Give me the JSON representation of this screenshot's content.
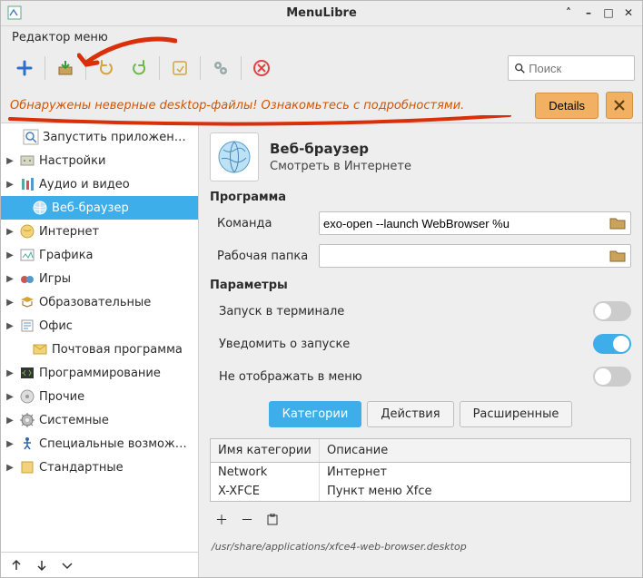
{
  "window": {
    "title": "MenuLibre"
  },
  "menubar": {
    "editor": "Редактор меню"
  },
  "search": {
    "placeholder": "Поиск"
  },
  "alert": {
    "text": "Обнаружены неверные desktop-файлы! Ознакомьтесь с подробностями.",
    "details": "Details"
  },
  "sidebar": {
    "items": [
      {
        "label": "Запустить приложен…",
        "expandable": false,
        "icon": "search",
        "indent": "search"
      },
      {
        "label": "Настройки",
        "expandable": true,
        "icon": "settings"
      },
      {
        "label": "Аудио и видео",
        "expandable": true,
        "icon": "audio"
      },
      {
        "label": "Веб-браузер",
        "expandable": false,
        "icon": "browser",
        "child": true,
        "selected": true
      },
      {
        "label": "Интернет",
        "expandable": true,
        "icon": "internet"
      },
      {
        "label": "Графика",
        "expandable": true,
        "icon": "graphics"
      },
      {
        "label": "Игры",
        "expandable": true,
        "icon": "games"
      },
      {
        "label": "Образовательные",
        "expandable": true,
        "icon": "education"
      },
      {
        "label": "Офис",
        "expandable": true,
        "icon": "office"
      },
      {
        "label": "Почтовая программа",
        "expandable": false,
        "icon": "mail",
        "child": true
      },
      {
        "label": "Программирование",
        "expandable": true,
        "icon": "dev"
      },
      {
        "label": "Прочие",
        "expandable": true,
        "icon": "other"
      },
      {
        "label": "Системные",
        "expandable": true,
        "icon": "system"
      },
      {
        "label": "Специальные возмож…",
        "expandable": true,
        "icon": "access"
      },
      {
        "label": "Стандартные",
        "expandable": true,
        "icon": "standard"
      }
    ]
  },
  "detail": {
    "title": "Веб-браузер",
    "subtitle": "Смотреть в Интернете",
    "program_label": "Программа",
    "command_label": "Команда",
    "command_value": "exo-open --launch WebBrowser %u",
    "workdir_label": "Рабочая папка",
    "workdir_value": "",
    "params_label": "Параметры",
    "terminal_label": "Запуск в терминале",
    "terminal_on": false,
    "notify_label": "Уведомить о запуске",
    "notify_on": true,
    "hide_label": "Не отображать в меню",
    "hide_on": false,
    "tabs": {
      "categories": "Категории",
      "actions": "Действия",
      "advanced": "Расширенные"
    },
    "cat_header": {
      "name": "Имя категории",
      "desc": "Описание"
    },
    "cat_rows": [
      {
        "name": "Network",
        "desc": "Интернет"
      },
      {
        "name": "X-XFCE",
        "desc": "Пункт меню Xfce"
      }
    ],
    "path": "/usr/share/applications/xfce4-web-browser.desktop"
  }
}
